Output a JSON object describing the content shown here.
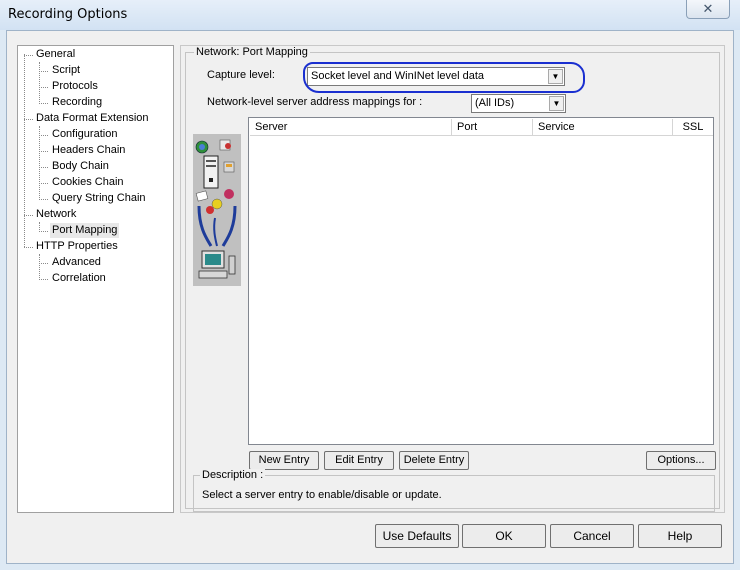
{
  "window": {
    "title": "Recording Options",
    "close_glyph": "✕"
  },
  "tree": {
    "items": [
      {
        "label": "General",
        "level": 0
      },
      {
        "label": "Script",
        "level": 1
      },
      {
        "label": "Protocols",
        "level": 1
      },
      {
        "label": "Recording",
        "level": 1
      },
      {
        "label": "Data Format Extension",
        "level": 0
      },
      {
        "label": "Configuration",
        "level": 1
      },
      {
        "label": "Headers Chain",
        "level": 1
      },
      {
        "label": "Body Chain",
        "level": 1
      },
      {
        "label": "Cookies Chain",
        "level": 1
      },
      {
        "label": "Query String Chain",
        "level": 1
      },
      {
        "label": "Network",
        "level": 0
      },
      {
        "label": "Port Mapping",
        "level": 1,
        "selected": true
      },
      {
        "label": "HTTP Properties",
        "level": 0
      },
      {
        "label": "Advanced",
        "level": 1
      },
      {
        "label": "Correlation",
        "level": 1
      }
    ]
  },
  "panel": {
    "group_title": "Network: Port Mapping",
    "capture_label": "Capture level:",
    "capture_value": "Socket level and WinINet level data",
    "mappings_label": "Network-level server address mappings for :",
    "mappings_value": "(All IDs)",
    "columns": [
      "Server",
      "Port",
      "Service",
      "SSL"
    ],
    "buttons": {
      "new_entry": "New Entry",
      "edit_entry": "Edit Entry",
      "delete_entry": "Delete Entry",
      "options": "Options..."
    },
    "description_title": "Description :",
    "description_text": "Select a server entry to enable/disable or update."
  },
  "footer": {
    "use_defaults": "Use Defaults",
    "ok": "OK",
    "cancel": "Cancel",
    "help": "Help"
  },
  "colors": {
    "highlight": "#1a2fd0"
  }
}
